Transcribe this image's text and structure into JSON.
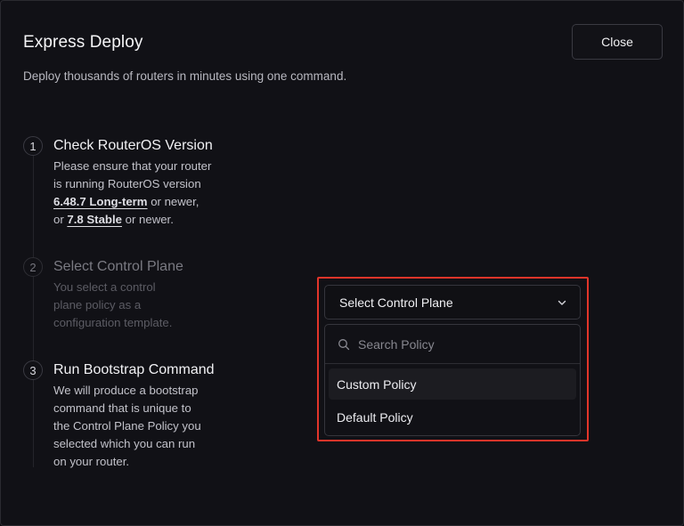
{
  "dialog": {
    "title": "Express Deploy",
    "subtitle": "Deploy thousands of routers in minutes using one command.",
    "close_label": "Close"
  },
  "steps": [
    {
      "number": "1",
      "title": "Check RouterOS Version",
      "desc_line1": "Please ensure that your router",
      "desc_line2": "is running RouterOS version",
      "version_long_term": "6.48.7 Long-term",
      "text_or_newer": " or newer,",
      "text_or": "or ",
      "version_stable": "7.8 Stable",
      "text_or_newer_end": " or newer.",
      "active": true
    },
    {
      "number": "2",
      "title": "Select Control Plane",
      "description": "You select a control plane policy as a configuration template.",
      "active": false
    },
    {
      "number": "3",
      "title": "Run Bootstrap Command",
      "description": "We will produce a bootstrap command that is unique to the Control Plane Policy you selected which you can run on your router.",
      "active": true
    }
  ],
  "control_plane_select": {
    "label": "Select Control Plane",
    "search_placeholder": "Search Policy",
    "options": [
      {
        "label": "Custom Policy",
        "highlighted": true
      },
      {
        "label": "Default Policy",
        "highlighted": false
      }
    ]
  },
  "colors": {
    "background": "#111116",
    "highlight_border": "#e2352a"
  },
  "icons": [
    "chevron-down-icon",
    "search-icon"
  ]
}
